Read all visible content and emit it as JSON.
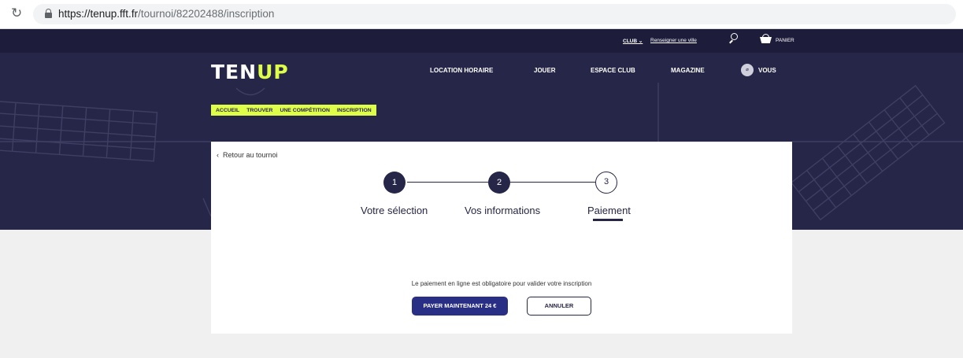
{
  "browser": {
    "url_host": "https://tenup.fft.fr",
    "url_path": "/tournoi/82202488/inscription",
    "icons": {
      "reload": "reload-icon",
      "lock": "lock-icon"
    }
  },
  "utility": {
    "club_label": "CLUB",
    "city_link": "Renseigner une ville",
    "cart_label": "PANIER",
    "icons": {
      "search": "search-icon",
      "cart": "basket-icon",
      "chevron": "chevron-down-icon"
    }
  },
  "logo": {
    "part1": "TEN",
    "part2": "UP"
  },
  "nav": {
    "items": [
      "LOCATION HORAIRE",
      "JOUER",
      "ESPACE CLUB",
      "MAGAZINE"
    ],
    "account_label": "VOUS"
  },
  "breadcrumb": [
    "ACCUEIL",
    "TROUVER",
    "UNE COMPÉTITION",
    "INSCRIPTION"
  ],
  "back_link": "Retour au tournoi",
  "steps": [
    {
      "number": "1",
      "label": "Votre sélection",
      "state": "done"
    },
    {
      "number": "2",
      "label": "Vos informations",
      "state": "done"
    },
    {
      "number": "3",
      "label": "Paiement",
      "state": "current"
    }
  ],
  "payment": {
    "notice": "Le paiement en ligne est obligatoire pour valider votre inscription",
    "pay_button": "PAYER MAINTENANT 24 €",
    "cancel_button": "ANNULER"
  },
  "colors": {
    "navy": "#262648",
    "lime": "#dffe4a",
    "button_blue": "#2a2f86",
    "page_bg": "#f0f0f0"
  }
}
